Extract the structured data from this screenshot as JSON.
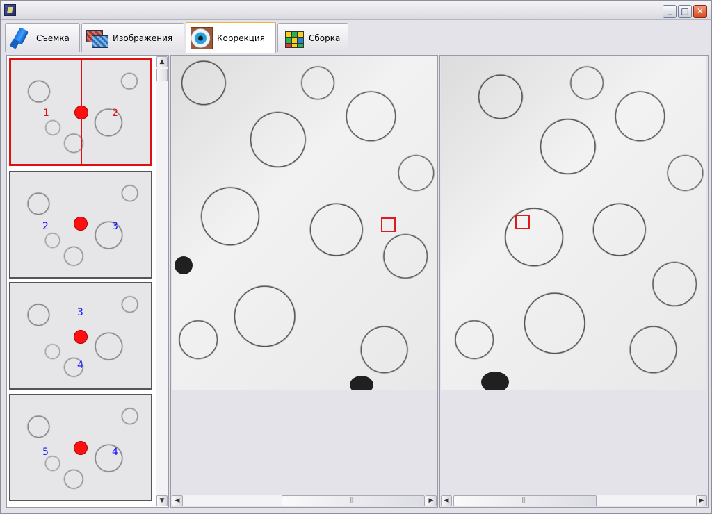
{
  "window": {
    "title": ""
  },
  "title_buttons": {
    "minimize": "_",
    "maximize": "□",
    "close": "✕"
  },
  "tabs": [
    {
      "label": "Съемка",
      "icon": "camera-icon"
    },
    {
      "label": "Изображения",
      "icon": "images-icon"
    },
    {
      "label": "Коррекция",
      "icon": "eye-icon",
      "active": true
    },
    {
      "label": "Сборка",
      "icon": "cube-icon"
    }
  ],
  "thumbnails": [
    {
      "left_num": "1",
      "right_num": "2",
      "orientation": "vertical",
      "selected": true
    },
    {
      "left_num": "2",
      "right_num": "3",
      "orientation": "vertical",
      "selected": false
    },
    {
      "left_num": "3",
      "right_num": "4",
      "orientation": "horizontal",
      "selected": false
    },
    {
      "left_num": "5",
      "right_num": "4",
      "orientation": "vertical",
      "selected": false
    }
  ],
  "scrollbars": {
    "up": "▲",
    "down": "▼",
    "left": "◀",
    "right": "▶",
    "grip": "|||"
  },
  "colors": {
    "selection": "#e01010",
    "marker": "#e01a1a",
    "number_blue": "#1010ff",
    "active_tab_border": "#f0b43c"
  }
}
